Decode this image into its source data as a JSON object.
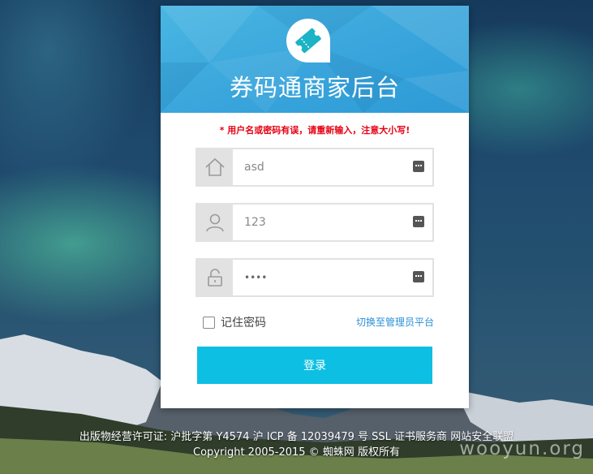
{
  "app": {
    "title": "券码通商家后台",
    "error_message": "* 用户名或密码有误，请重新输入，注意大小写!"
  },
  "form": {
    "store_field": {
      "value": "asd",
      "icon": "home-icon"
    },
    "username_field": {
      "value": "123",
      "icon": "user-icon"
    },
    "password_field": {
      "value": "••••",
      "icon": "lock-icon"
    },
    "remember_label": "记住密码",
    "remember_checked": false,
    "switch_link": "切换至管理员平台",
    "login_button": "登录"
  },
  "footer": {
    "line1": "出版物经营许可证: 沪批字第 Y4574 沪 ICP 备 12039479 号 SSL 证书服务商 网站安全联盟",
    "line2": "Copyright 2005-2015 © 蜘蛛网 版权所有"
  },
  "watermark": "wooyun.org",
  "colors": {
    "header_blue": "#3aa6dc",
    "button_cyan": "#0dbfe3",
    "error_red": "#e60012",
    "link_blue": "#2a8fd8"
  }
}
